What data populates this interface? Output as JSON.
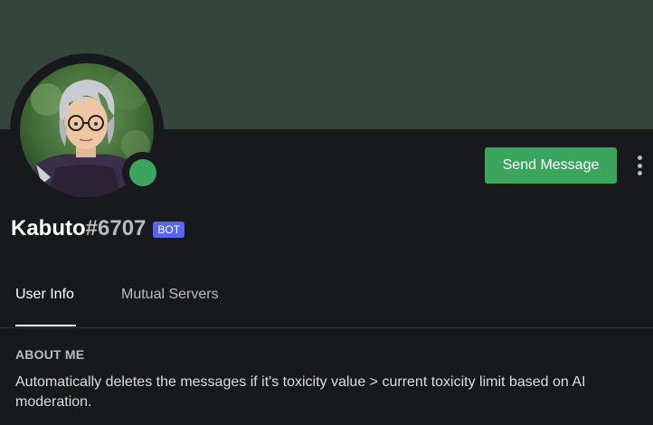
{
  "profile": {
    "username": "Kabuto",
    "discriminator": "#6707",
    "bot_tag": "BOT",
    "status": "online"
  },
  "actions": {
    "send_message_label": "Send Message",
    "more_icon": "more-vertical-icon"
  },
  "tabs": [
    {
      "label": "User Info",
      "active": true
    },
    {
      "label": "Mutual Servers",
      "active": false
    }
  ],
  "about": {
    "heading": "ABOUT ME",
    "text": "Automatically deletes the messages if it's toxicity value > current toxicity limit  based on AI moderation."
  },
  "colors": {
    "banner": "#34463b",
    "background": "#18191c",
    "online": "#3ba55d",
    "send_button": "#3ba55d",
    "bot_tag": "#5865f2"
  }
}
